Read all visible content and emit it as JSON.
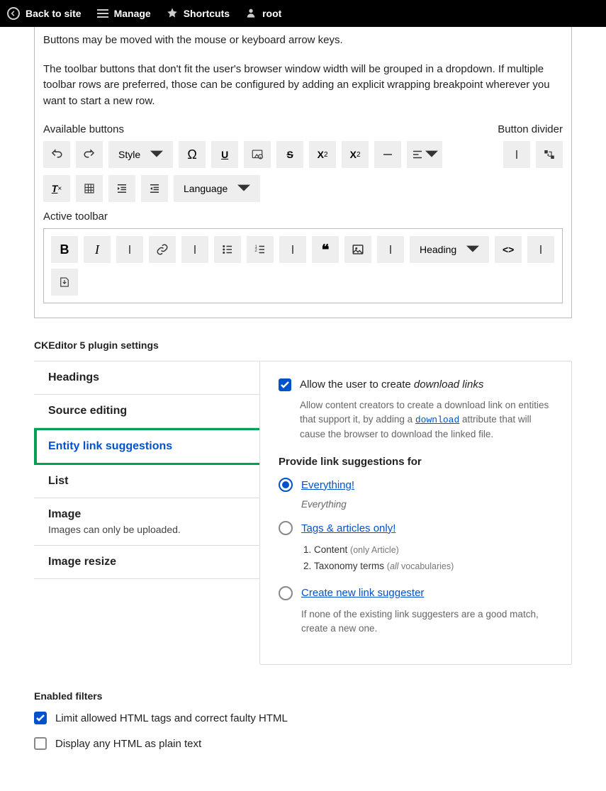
{
  "toolbar": {
    "back": "Back to site",
    "manage": "Manage",
    "shortcuts": "Shortcuts",
    "user": "root"
  },
  "config": {
    "desc1": "Buttons may be moved with the mouse or keyboard arrow keys.",
    "desc2": "The toolbar buttons that don't fit the user's browser window width will be grouped in a dropdown. If multiple toolbar rows are preferred, those can be configured by adding an explicit wrapping breakpoint wherever you want to start a new row.",
    "available_label": "Available buttons",
    "divider_label": "Button divider",
    "style_label": "Style",
    "language_label": "Language",
    "active_label": "Active toolbar",
    "heading_label": "Heading"
  },
  "plugins": {
    "section_title": "CKEditor 5 plugin settings",
    "tabs": {
      "headings": "Headings",
      "source": "Source editing",
      "entity": "Entity link suggestions",
      "list": "List",
      "image": "Image",
      "image_desc": "Images can only be uploaded.",
      "resize": "Image resize"
    },
    "panel": {
      "allow_download_pre": "Allow the user to create ",
      "allow_download_em": "download links",
      "download_help_pre": "Allow content creators to create a download link on entities that support it, by adding a ",
      "download_link": "download",
      "download_help_post": " attribute that will cause the browser to download the linked file.",
      "suggest_title": "Provide link suggestions for",
      "everything": "Everything!",
      "everything_help": "Everything",
      "tags": "Tags & articles only!",
      "tags_list1_pre": "Content ",
      "tags_list1_muted": "(only Article)",
      "tags_list2_pre": "Taxonomy terms ",
      "tags_list2_muted_pre": "(",
      "tags_list2_muted_em": "all",
      "tags_list2_muted_post": " vocabularies)",
      "create": "Create new link suggester",
      "create_help": "If none of the existing link suggesters are a good match, create a new one."
    }
  },
  "filters": {
    "title": "Enabled filters",
    "limit": "Limit allowed HTML tags and correct faulty HTML",
    "plain": "Display any HTML as plain text"
  }
}
